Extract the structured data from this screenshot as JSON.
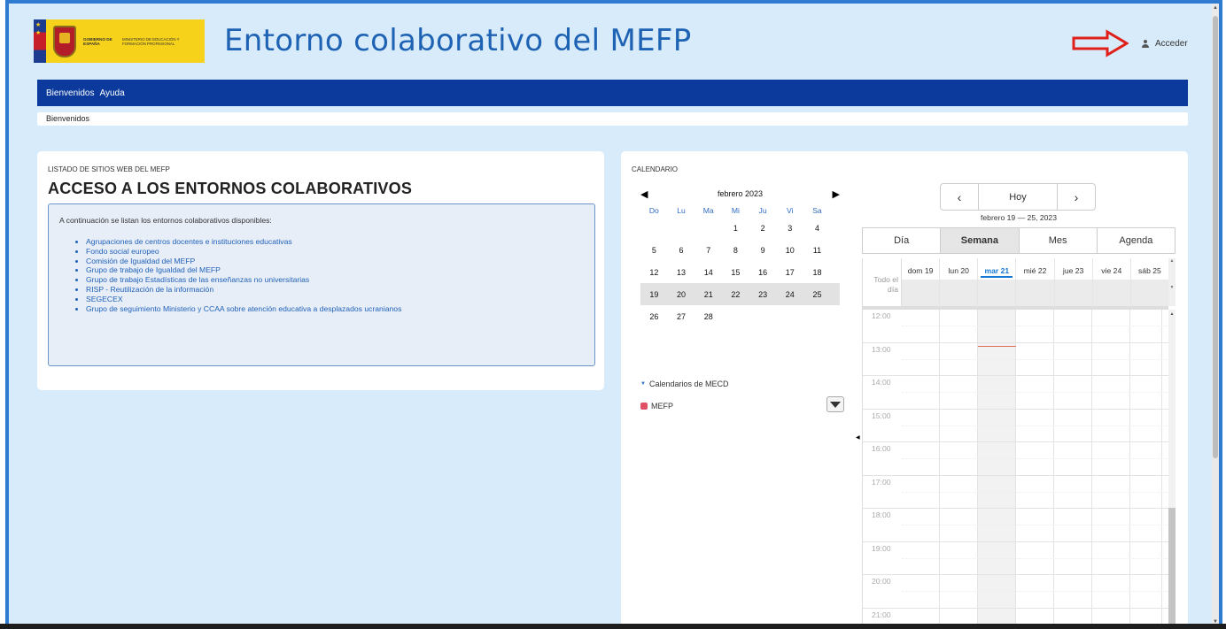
{
  "header": {
    "logo": {
      "gov_text": "GOBIERNO DE ESPAÑA",
      "ministry_text": "MINISTERIO DE EDUCACIÓN Y FORMACIÓN PROFESIONAL"
    },
    "site_title": "Entorno colaborativo del MEFP",
    "login_label": "Acceder",
    "annotation_color": "#e0201b"
  },
  "nav": {
    "items": [
      "Bienvenidos",
      "Ayuda"
    ],
    "breadcrumb": "Bienvenidos",
    "color": "#0b3a9c"
  },
  "sites_portlet": {
    "subtitle": "LISTADO DE SITIOS WEB DEL MEFP",
    "title": "ACCESO A LOS ENTORNOS COLABORATIVOS",
    "intro": "A continuación se listan los entornos colaborativos disponibles:",
    "links": [
      "Agrupaciones de centros docentes e instituciones educativas",
      "Fondo social europeo",
      "Comisión de Igualdad del MEFP",
      "Grupo de trabajo de Igualdad del MEFP",
      "Grupo de trabajo Estadísticas de las enseñanzas no universitarias",
      "RISP - Reutilización de la información",
      "SEGECEX",
      "Grupo de seguimiento Ministerio y CCAA sobre atención educativa a desplazados ucranianos"
    ]
  },
  "calendar": {
    "subtitle": "CALENDARIO",
    "mini": {
      "month_label": "febrero 2023",
      "weekdays": [
        "Do",
        "Lu",
        "Ma",
        "Mi",
        "Ju",
        "Vi",
        "Sa"
      ],
      "weeks": [
        [
          "",
          "",
          "",
          "1",
          "2",
          "3",
          "4"
        ],
        [
          "5",
          "6",
          "7",
          "8",
          "9",
          "10",
          "11"
        ],
        [
          "12",
          "13",
          "14",
          "15",
          "16",
          "17",
          "18"
        ],
        [
          "19",
          "20",
          "21",
          "22",
          "23",
          "24",
          "25"
        ],
        [
          "26",
          "27",
          "28",
          "",
          "",
          "",
          ""
        ]
      ],
      "selected_week": 3
    },
    "calendars_group": "Calendarios de MECD",
    "calendar_items": [
      {
        "name": "MEFP",
        "color": "#e05168"
      }
    ],
    "scheduler": {
      "prev": "‹",
      "today": "Hoy",
      "next": "›",
      "range_label": "febrero 19 — 25, 2023",
      "views": [
        "Día",
        "Semana",
        "Mes",
        "Agenda"
      ],
      "active_view": "Semana",
      "all_day_label": "Todo el día",
      "days": [
        "dom 19",
        "lun 20",
        "mar 21",
        "mié 22",
        "jue 23",
        "vie 24",
        "sáb 25"
      ],
      "today_index": 2,
      "hours": [
        "12:00",
        "13:00",
        "14:00",
        "15:00",
        "16:00",
        "17:00",
        "18:00",
        "19:00",
        "20:00",
        "21:00"
      ]
    }
  }
}
